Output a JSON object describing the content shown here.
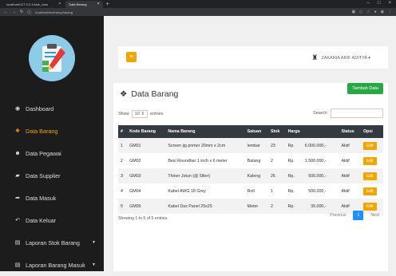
{
  "browser": {
    "tabs": [
      {
        "label": "localhost/127.0.0.1/stok_baru"
      },
      {
        "label": "Data Barang"
      }
    ],
    "url": "localhost/inventory/barang",
    "new_tab": "+",
    "window_controls": [
      "–",
      "□",
      "×"
    ]
  },
  "sidebar": {
    "items": [
      {
        "label": "Dashboard",
        "icon": "tachometer-icon",
        "glyph": "◉",
        "active": false,
        "caret": false
      },
      {
        "label": "Data Barang",
        "icon": "cubes-icon",
        "glyph": "❖",
        "active": true,
        "caret": false
      },
      {
        "label": "Data Pegawai",
        "icon": "users-icon",
        "glyph": "☻",
        "active": false,
        "caret": false
      },
      {
        "label": "Data Supplier",
        "icon": "truck-icon",
        "glyph": "▰",
        "active": false,
        "caret": false
      },
      {
        "label": "Data Masuk",
        "icon": "share-icon",
        "glyph": "➦",
        "active": false,
        "caret": false
      },
      {
        "label": "Data Keluar",
        "icon": "reply-icon",
        "glyph": "↶",
        "active": false,
        "caret": false
      },
      {
        "label": "Laporan Stok Barang",
        "icon": "file-icon",
        "glyph": "▤",
        "active": false,
        "caret": true
      },
      {
        "label": "Laporan Barang Masuk",
        "icon": "file-icon",
        "glyph": "▤",
        "active": false,
        "caret": true
      }
    ]
  },
  "topbar": {
    "user_name": "ZAKARIA ARIF ADITYA ▾"
  },
  "content": {
    "title": "Data Barang",
    "add_button": "Tambah Data",
    "show_label": "Show",
    "show_value": "10 ⇕",
    "entries_label": "entries",
    "search_label": "Search:",
    "columns": [
      "#",
      "Kode Barang",
      "Nama Barang",
      "Satuan",
      "Stok",
      "Harga",
      "Status",
      "Opsi"
    ],
    "rows": [
      {
        "no": "1",
        "kode": "GM01",
        "nama": "Screen jig primer 20mm x 2cm",
        "satuan": "lembar",
        "stok": "23",
        "rp": "Rp.",
        "harga": "6.000.000,-",
        "status": "Aktif",
        "opsi": "Edit"
      },
      {
        "no": "2",
        "kode": "GM02",
        "nama": "Besi Roundbar 1 inch x 6 meter",
        "satuan": "Batang",
        "stok": "2",
        "rp": "Rp.",
        "harga": "1.500.000,-",
        "status": "Aktif",
        "opsi": "Edit"
      },
      {
        "no": "3",
        "kode": "GM03",
        "nama": "Thiner Jotun (@ 5liter)",
        "satuan": "Kaleng",
        "stok": "26",
        "rp": "Rp.",
        "harga": "500.000,-",
        "status": "Aktif",
        "opsi": "Edit"
      },
      {
        "no": "4",
        "kode": "GM04",
        "nama": "Kabel AWG 18 Grey",
        "satuan": "Roll",
        "stok": "1",
        "rp": "Rp.",
        "harga": "500.000,-",
        "status": "Aktif",
        "opsi": "Edit"
      },
      {
        "no": "5",
        "kode": "GM05",
        "nama": "Kabel Dax Panel 25x25",
        "satuan": "Meter",
        "stok": "2",
        "rp": "Rp.",
        "harga": "35.000,-",
        "status": "Aktif",
        "opsi": "Edit"
      }
    ],
    "info": "Showing 1 to 5 of 5 entries",
    "pagination": {
      "prev": "Previous",
      "page": "1",
      "next": "Next"
    }
  },
  "colors": {
    "accent": "#f0a500",
    "success": "#28a745",
    "primary": "#1e90ff",
    "sidebar": "#1c1c1c",
    "table_head": "#343a40"
  }
}
